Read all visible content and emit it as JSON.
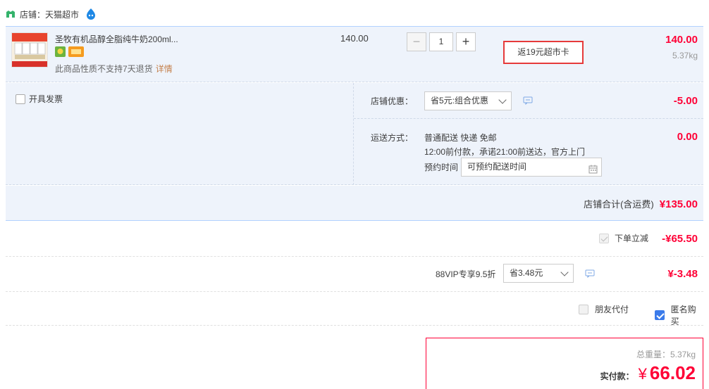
{
  "shop": {
    "label": "店铺：天猫超市"
  },
  "item": {
    "title": "圣牧有机品醇全脂纯牛奶200ml...",
    "no_return": "此商品性质不支持7天退货",
    "no_return_link": "详情",
    "unit_price": "140.00",
    "quantity": "1",
    "promo": "返19元超市卡",
    "total": "140.00",
    "weight": "5.37kg"
  },
  "invoice": {
    "label": "开具发票"
  },
  "shop_discount": {
    "label": "店铺优惠：",
    "selected": "省5元:组合优惠",
    "amount": "-5.00"
  },
  "shipping": {
    "label": "运送方式：",
    "line1": "普通配送 快递 免邮",
    "line2": "12:00前付款，承诺21:00前送达，官方上门",
    "time_label": "预约时间",
    "time_value": "可预约配送时间",
    "amount": "0.00"
  },
  "shop_total": {
    "label": "店铺合计(含运费)",
    "amount": "¥135.00"
  },
  "instant_discount": {
    "label": "下单立减",
    "amount": "-¥65.50"
  },
  "vip": {
    "label": "88VIP专享9.5折",
    "selected": "省3.48元",
    "amount": "¥-3.48"
  },
  "options": {
    "friend_pay": "朋友代付",
    "anonymous": "匿名购买"
  },
  "summary": {
    "weight": "总重量：5.37kg",
    "pay_label": "实付款：",
    "currency": "¥",
    "amount": "66.02"
  },
  "colors": {
    "price_red": "#ff0036",
    "panel_blue": "#eef3fb",
    "promo_border": "#e63a3a",
    "checkbox_blue": "#3b7bea"
  }
}
